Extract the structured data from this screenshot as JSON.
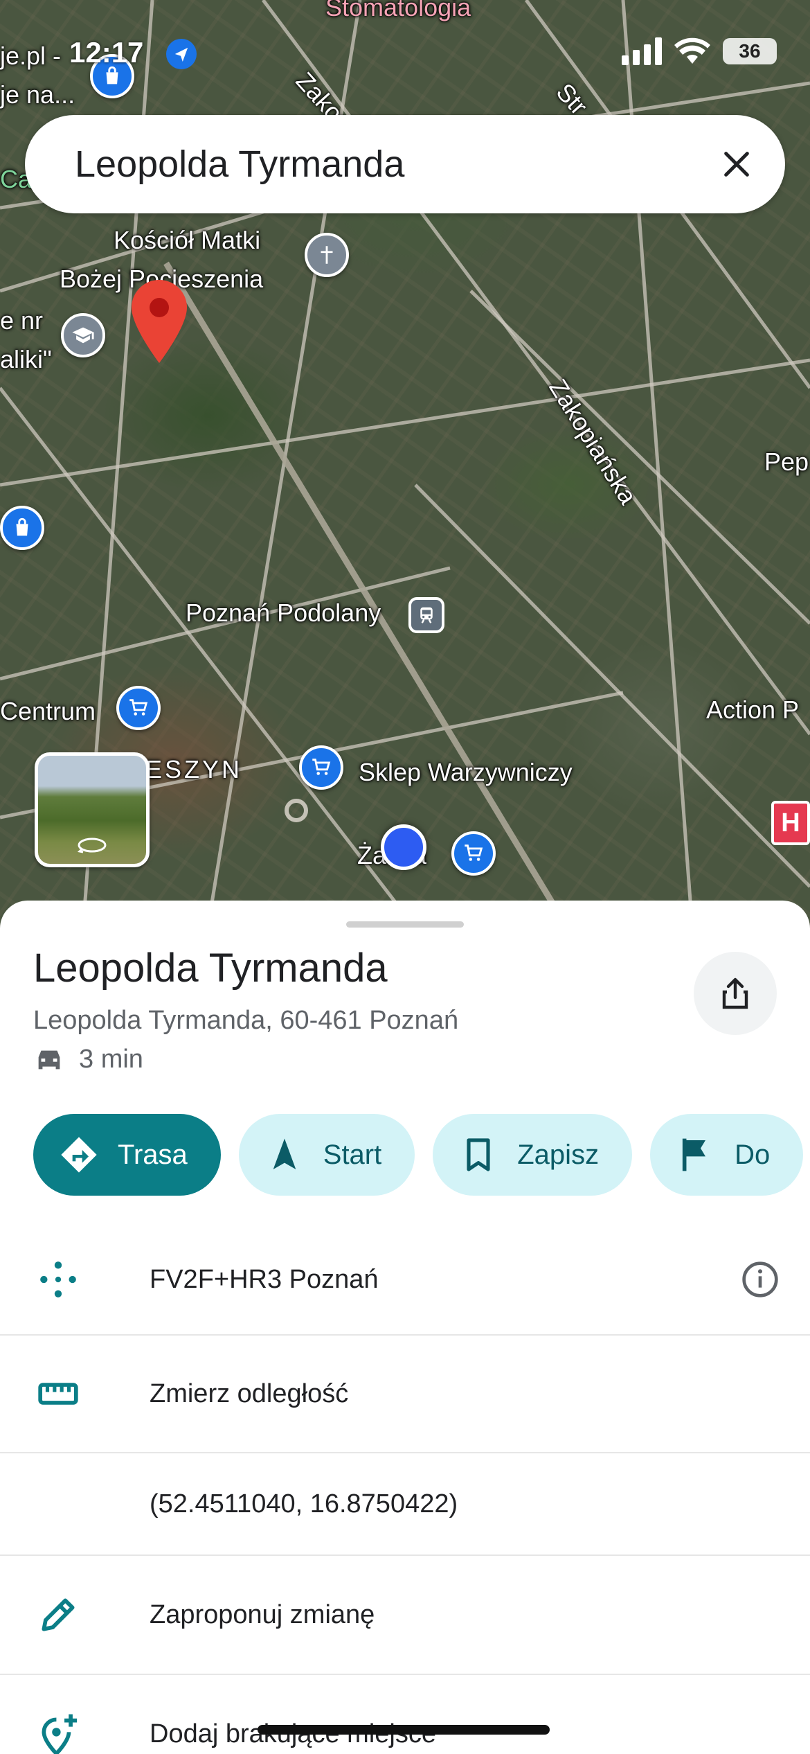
{
  "status_bar": {
    "time": "12:17",
    "battery": "36"
  },
  "search": {
    "query": "Leopolda Tyrmanda"
  },
  "map_labels": {
    "top_center": "Stomatologia",
    "top_left_1": "je.pl -",
    "top_left_2": "je na...",
    "left_ca": "Ca",
    "church_1": "Kościół Matki",
    "church_2": "Bożej Pocieszenia",
    "school_1": "e nr",
    "school_2": "aliki\"",
    "street_zakopianska_top": "Zakopi",
    "street_str": "Str",
    "street_zakopianska": "Zakopiańska",
    "pep": "Pep",
    "station": "Poznań Podolany",
    "centrum": "Centrum",
    "district": "ESZYN",
    "shop": "Sklep Warzywniczy",
    "zabka": "Żabka",
    "action": "Action P",
    "hospital": "H"
  },
  "place": {
    "title": "Leopolda Tyrmanda",
    "address": "Leopolda Tyrmanda, 60-461 Poznań",
    "drive_time": "3 min"
  },
  "actions": [
    {
      "label": "Trasa",
      "icon": "directions-icon"
    },
    {
      "label": "Start",
      "icon": "navigation-arrow-icon"
    },
    {
      "label": "Zapisz",
      "icon": "bookmark-icon"
    },
    {
      "label": "Do",
      "icon": "flag-icon"
    }
  ],
  "rows": [
    {
      "text": "FV2F+HR3 Poznań",
      "icon": "plus-code-icon"
    },
    {
      "text": "Zmierz odległość",
      "icon": "ruler-icon"
    },
    {
      "text": "(52.4511040, 16.8750422)",
      "icon": ""
    },
    {
      "text": "Zaproponuj zmianę",
      "icon": "pencil-icon"
    },
    {
      "text": "Dodaj brakujące miejsce",
      "icon": "add-place-icon"
    }
  ],
  "colors": {
    "accent": "#0b7e87",
    "chip_bg": "#d3f3f7",
    "pin_blue": "#1a73e8",
    "marker_red": "#ea4335"
  }
}
